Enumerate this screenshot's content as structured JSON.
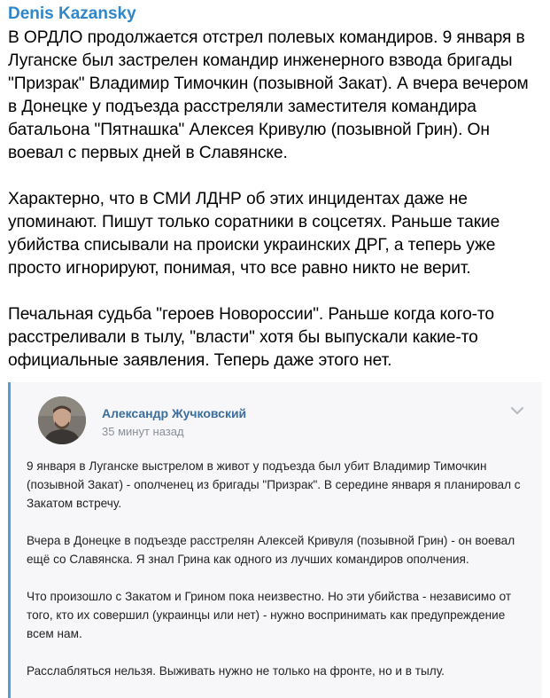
{
  "post": {
    "author": "Denis Kazansky",
    "paragraphs": [
      "В ОРДЛО продолжается отстрел полевых командиров. 9 января в Луганске был застрелен командир инженерного взвода бригады \"Призрак\" Владимир Тимочкин (позывной Закат). А вчера вечером в Донецке у подъезда расстреляли заместителя командира батальона \"Пятнашка\" Алексея Кривулю (позывной Грин). Он воевал с первых дней в Славянске.",
      "Характерно, что в СМИ ЛДНР об этих инцидентах даже не упоминают. Пишут только соратники в соцсетях. Раньше такие убийства списывали на происки украинских ДРГ, а теперь уже просто игнорируют, понимая, что все равно никто не верит.",
      "Печальная судьба \"героев Новороссии\". Раньше когда кого-то расстреливали в тылу, \"власти\" хотя бы выпускали какие-то официальные заявления. Теперь даже этого нет."
    ]
  },
  "quoted": {
    "name": "Александр Жучковский",
    "time": "35 минут назад",
    "paragraphs": [
      "9 января в Луганске выстрелом в живот у подъезда был убит Владимир Тимочкин (позывной Закат) - ополченец из бригады \"Призрак\". В середине января я планировал с Закатом встречу.",
      "Вчера в Донецке в подъезде расстрелян Алексей Кривуля (позывной Грин) - он воевал ещё со Славянска. Я знал Грина как одного из лучших командиров ополчения.",
      "Что произошло с Закатом и Грином пока неизвестно. Но эти убийства - независимо от того, кто их совершил (украинцы или нет) - нужно воспринимать как предупреждение всем нам.",
      "Расслабляться нельзя. Выживать нужно не только на фронте, но и в тылу."
    ],
    "icons": {
      "avatar": "profile-photo",
      "menu": "chevron-down-icon"
    }
  },
  "colors": {
    "author": "#2f86c9",
    "quote_bar": "#4e9fd8",
    "quote_bg": "#f7f7f9",
    "quoted_name": "#3a6e9e",
    "timestamp": "#8a8f96"
  }
}
